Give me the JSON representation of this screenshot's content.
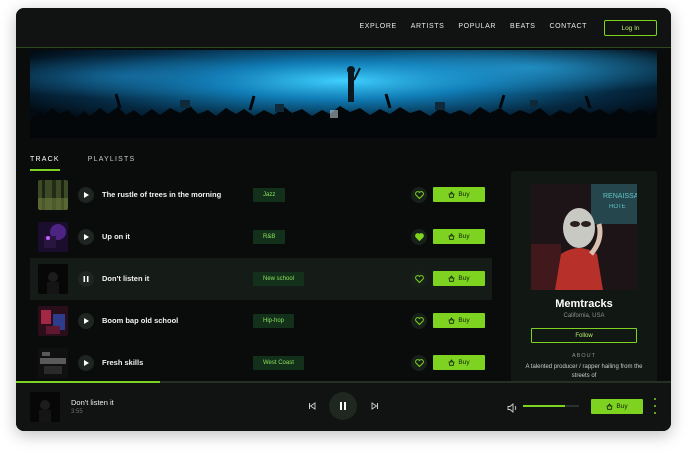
{
  "nav": {
    "links": [
      "EXPLORE",
      "ARTISTS",
      "POPULAR",
      "BEATS",
      "CONTACT"
    ],
    "login_label": "Log In"
  },
  "tabs": [
    "TRACK",
    "PLAYLISTS"
  ],
  "tracks": [
    {
      "title": "The rustle of trees in the morning",
      "genre": "Jazz",
      "liked": false,
      "playing": false
    },
    {
      "title": "Up on it",
      "genre": "R&B",
      "liked": true,
      "playing": false
    },
    {
      "title": "Don't listen it",
      "genre": "New school",
      "liked": false,
      "playing": true
    },
    {
      "title": "Boom bap old school",
      "genre": "Hip-hop",
      "liked": false,
      "playing": false
    },
    {
      "title": "Fresh skills",
      "genre": "West Coast",
      "liked": false,
      "playing": false
    }
  ],
  "buy_label": "Buy",
  "artist": {
    "name": "Memtracks",
    "location": "California, USA",
    "follow_label": "Follow",
    "about_heading": "ABOUT",
    "about_text": "A talented producer / rapper hailing from the streets of"
  },
  "player": {
    "title": "Don't listen it",
    "time": "3:55",
    "progress": 0.22,
    "volume": 0.75,
    "buy_label": "Buy"
  },
  "colors": {
    "accent": "#7ed321",
    "background": "#0a0c0b",
    "genre_bg": "#13301a",
    "genre_text": "#8be35e"
  }
}
